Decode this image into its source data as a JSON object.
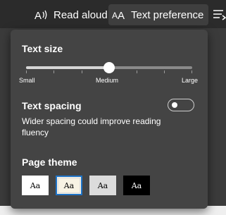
{
  "toolbar": {
    "read_aloud": {
      "label": "Read aloud",
      "icon": "read-aloud-icon"
    },
    "text_preference": {
      "label": "Text preference",
      "icon": "text-preference-icon",
      "active": true
    },
    "more": {
      "icon": "more-options-icon"
    }
  },
  "panel": {
    "text_size": {
      "title": "Text size",
      "labels": {
        "min": "Small",
        "mid": "Medium",
        "max": "Large"
      },
      "value_fraction": 0.5
    },
    "text_spacing": {
      "title": "Text spacing",
      "description": "Wider spacing could improve reading fluency",
      "enabled": false
    },
    "page_theme": {
      "title": "Page theme",
      "options": [
        {
          "label": "Aa",
          "background": "#ffffff",
          "text": "#000000",
          "selected": false
        },
        {
          "label": "Aa",
          "background": "#f8f3e4",
          "text": "#000000",
          "selected": true
        },
        {
          "label": "Aa",
          "background": "#dcdcdc",
          "text": "#000000",
          "selected": false
        },
        {
          "label": "Aa",
          "background": "#000000",
          "text": "#ffffff",
          "selected": false
        }
      ]
    }
  },
  "colors": {
    "panel_bg": "#444444",
    "toolbar_bg": "#2b2b2b",
    "accent": "#1f74c8"
  }
}
